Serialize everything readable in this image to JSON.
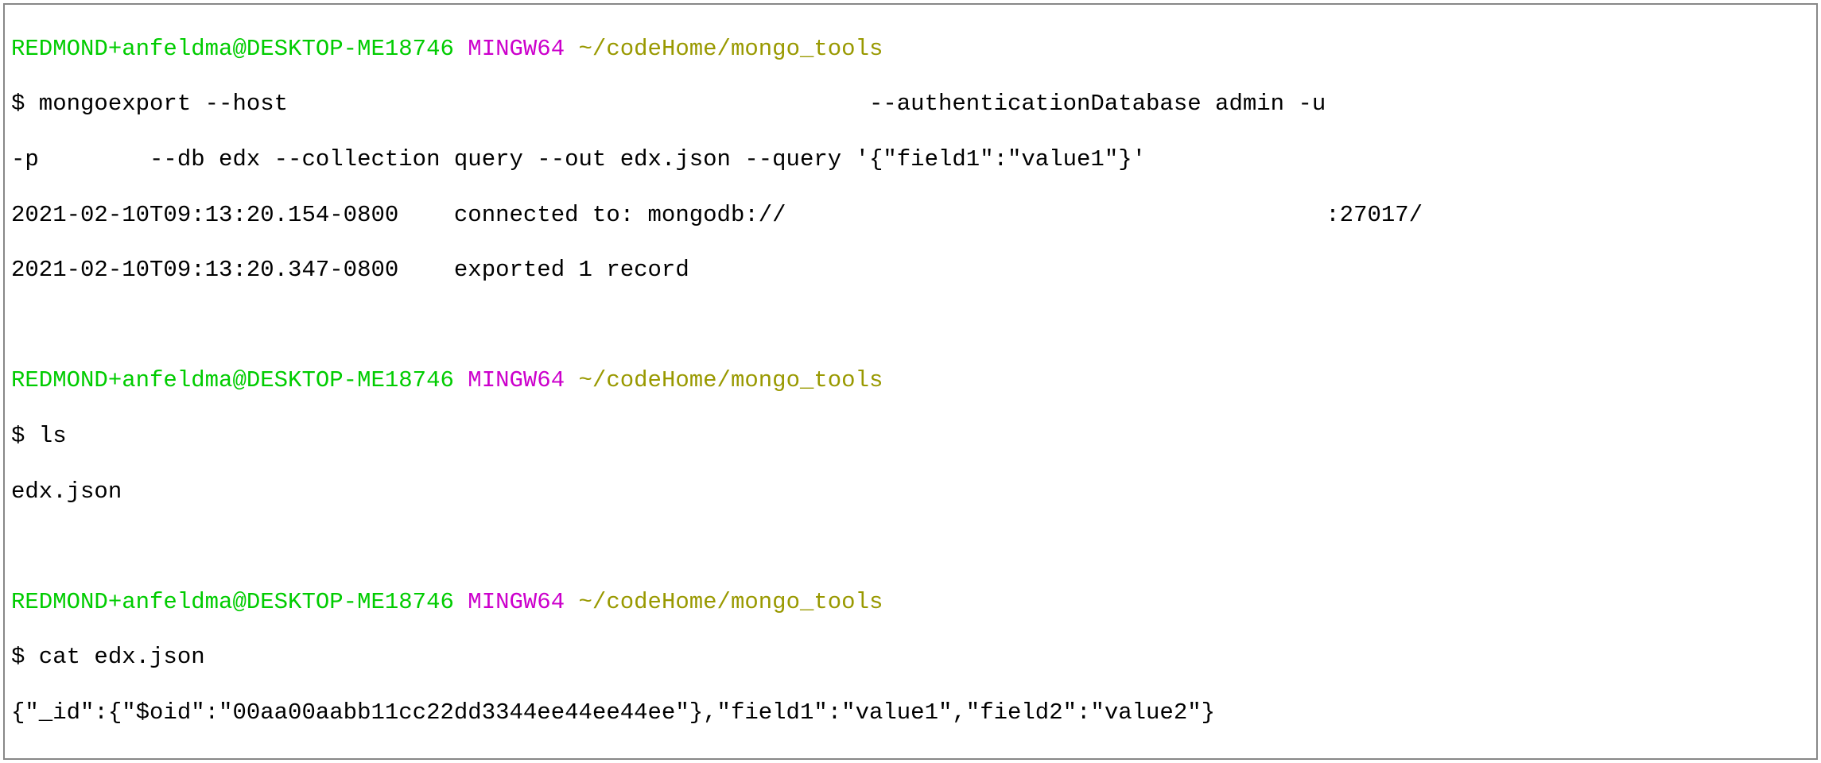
{
  "prompts": [
    {
      "user": "REDMOND+anfeldma@DESKTOP-ME18746",
      "env": "MINGW64",
      "path": "~/codeHome/mongo_tools"
    },
    {
      "user": "REDMOND+anfeldma@DESKTOP-ME18746",
      "env": "MINGW64",
      "path": "~/codeHome/mongo_tools"
    },
    {
      "user": "REDMOND+anfeldma@DESKTOP-ME18746",
      "env": "MINGW64",
      "path": "~/codeHome/mongo_tools"
    }
  ],
  "block1": {
    "cmd_line1": "$ mongoexport --host                                          --authenticationDatabase admin -u",
    "cmd_line2": "-p        --db edx --collection query --out edx.json --query '{\"field1\":\"value1\"}'",
    "out_line1": "2021-02-10T09:13:20.154-0800    connected to: mongodb://                                       :27017/",
    "out_line2": "2021-02-10T09:13:20.347-0800    exported 1 record"
  },
  "block2": {
    "cmd": "$ ls",
    "out": "edx.json"
  },
  "block3": {
    "cmd": "$ cat edx.json",
    "out": "{\"_id\":{\"$oid\":\"00aa00aabb11cc22dd3344ee44ee44ee\"},\"field1\":\"value1\",\"field2\":\"value2\"}"
  },
  "blank": " "
}
